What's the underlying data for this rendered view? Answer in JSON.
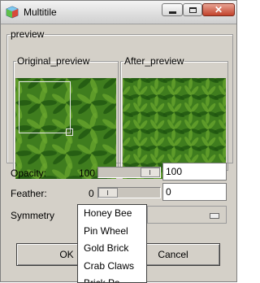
{
  "window": {
    "title": "Multitile",
    "close_glyph": "✕"
  },
  "preview": {
    "group_label": "preview",
    "original_label": "Original_preview",
    "after_label": "After_preview"
  },
  "opacity": {
    "label": "Opacity:",
    "value_label": "100",
    "field_value": "100",
    "level": 1.0
  },
  "feather": {
    "label": "Feather:",
    "value_label": "0",
    "field_value": "0",
    "level": 0.0
  },
  "symmetry": {
    "label": "Symmetry",
    "options": [
      "Honey Bee",
      "Pin Wheel",
      "Gold Brick",
      "Crab Claws",
      "Brick Pa..."
    ]
  },
  "buttons": {
    "ok": "OK",
    "cancel": "Cancel"
  },
  "colors": {
    "texture_base": "#3f7d1e",
    "leaf": "#1f5410",
    "leaf_light": "#6aa52e",
    "dialog_bg": "#d4d0c8"
  },
  "icons": {
    "app": "gimp-multitile-icon",
    "minimize": "minimize-icon",
    "maximize": "maximize-icon",
    "close": "close-icon"
  }
}
